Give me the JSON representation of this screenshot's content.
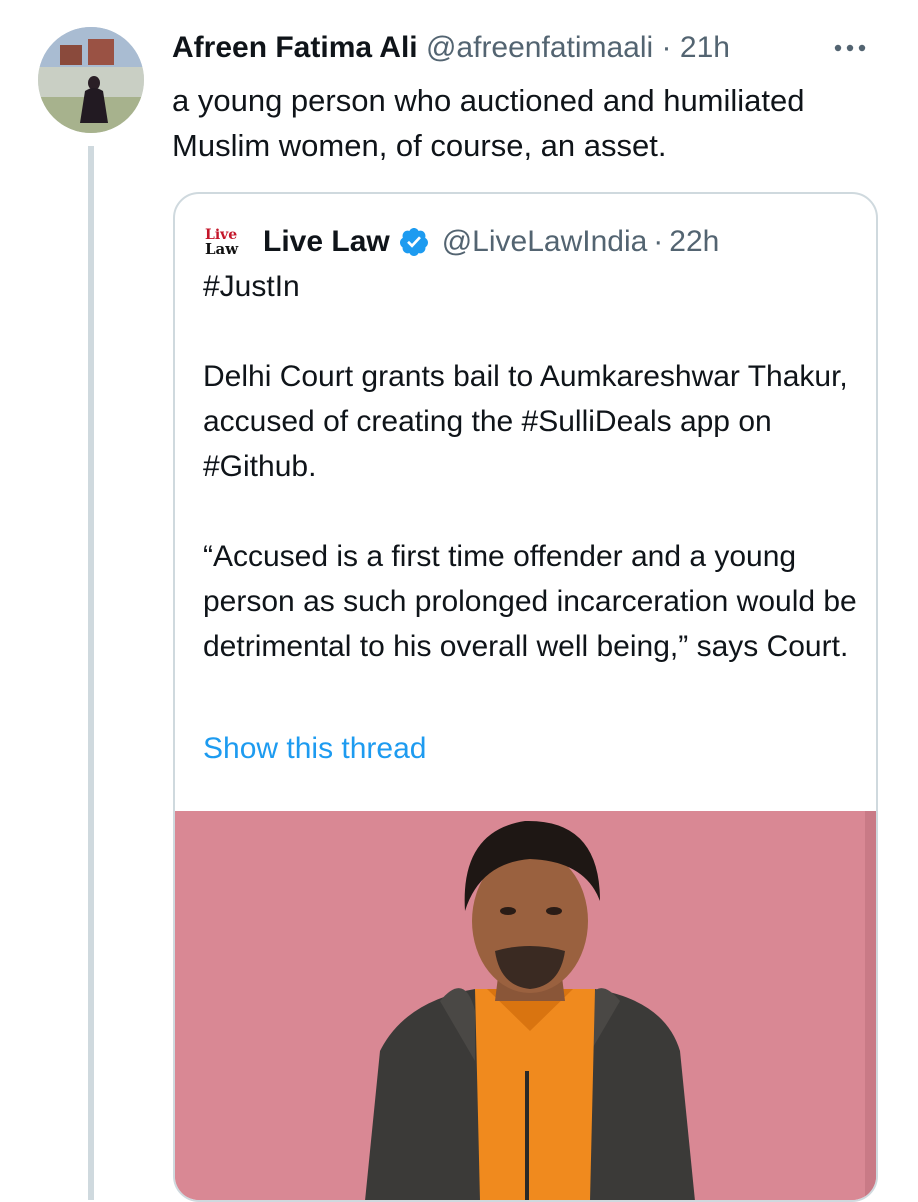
{
  "tweet": {
    "author_name": "Afreen Fatima Ali",
    "author_handle": "@afreenfatimaali",
    "separator": "·",
    "time": "21h",
    "text": "a young person who auctioned and humiliated Muslim women, of course, an asset.",
    "icons": {
      "more": "more-horizontal-icon",
      "avatar": "profile-photo"
    }
  },
  "quoted_tweet": {
    "logo_line1": "Live",
    "logo_line2": "Law",
    "author_name": "Live Law",
    "author_handle": "@LiveLawIndia",
    "separator": "·",
    "time": "22h",
    "verified_icon": "verified-badge-icon",
    "paragraphs": [
      "#JustIn",
      "Delhi Court grants bail to Aumkareshwar Thakur, accused of creating the #SulliDeals app on #Github.",
      "“Accused is a first time offender and a young person as such prolonged incarceration would be detrimental to his overall well being,” says Court."
    ],
    "show_thread": "Show this thread",
    "media": "photo of a young man in an orange shirt and dark hoodie against a pink background"
  },
  "colors": {
    "text": "#0f1419",
    "muted": "#536471",
    "link": "#1d9bf0",
    "border": "#cfd9de",
    "photo_background": "#d88893"
  }
}
